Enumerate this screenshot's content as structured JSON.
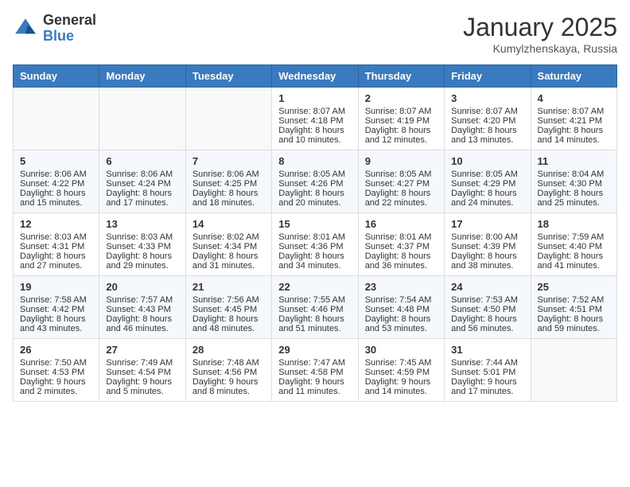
{
  "header": {
    "logo_general": "General",
    "logo_blue": "Blue",
    "month_title": "January 2025",
    "location": "Kumylzhenskaya, Russia"
  },
  "weekdays": [
    "Sunday",
    "Monday",
    "Tuesday",
    "Wednesday",
    "Thursday",
    "Friday",
    "Saturday"
  ],
  "weeks": [
    [
      {
        "day": "",
        "content": ""
      },
      {
        "day": "",
        "content": ""
      },
      {
        "day": "",
        "content": ""
      },
      {
        "day": "1",
        "content": "Sunrise: 8:07 AM\nSunset: 4:18 PM\nDaylight: 8 hours\nand 10 minutes."
      },
      {
        "day": "2",
        "content": "Sunrise: 8:07 AM\nSunset: 4:19 PM\nDaylight: 8 hours\nand 12 minutes."
      },
      {
        "day": "3",
        "content": "Sunrise: 8:07 AM\nSunset: 4:20 PM\nDaylight: 8 hours\nand 13 minutes."
      },
      {
        "day": "4",
        "content": "Sunrise: 8:07 AM\nSunset: 4:21 PM\nDaylight: 8 hours\nand 14 minutes."
      }
    ],
    [
      {
        "day": "5",
        "content": "Sunrise: 8:06 AM\nSunset: 4:22 PM\nDaylight: 8 hours\nand 15 minutes."
      },
      {
        "day": "6",
        "content": "Sunrise: 8:06 AM\nSunset: 4:24 PM\nDaylight: 8 hours\nand 17 minutes."
      },
      {
        "day": "7",
        "content": "Sunrise: 8:06 AM\nSunset: 4:25 PM\nDaylight: 8 hours\nand 18 minutes."
      },
      {
        "day": "8",
        "content": "Sunrise: 8:05 AM\nSunset: 4:26 PM\nDaylight: 8 hours\nand 20 minutes."
      },
      {
        "day": "9",
        "content": "Sunrise: 8:05 AM\nSunset: 4:27 PM\nDaylight: 8 hours\nand 22 minutes."
      },
      {
        "day": "10",
        "content": "Sunrise: 8:05 AM\nSunset: 4:29 PM\nDaylight: 8 hours\nand 24 minutes."
      },
      {
        "day": "11",
        "content": "Sunrise: 8:04 AM\nSunset: 4:30 PM\nDaylight: 8 hours\nand 25 minutes."
      }
    ],
    [
      {
        "day": "12",
        "content": "Sunrise: 8:03 AM\nSunset: 4:31 PM\nDaylight: 8 hours\nand 27 minutes."
      },
      {
        "day": "13",
        "content": "Sunrise: 8:03 AM\nSunset: 4:33 PM\nDaylight: 8 hours\nand 29 minutes."
      },
      {
        "day": "14",
        "content": "Sunrise: 8:02 AM\nSunset: 4:34 PM\nDaylight: 8 hours\nand 31 minutes."
      },
      {
        "day": "15",
        "content": "Sunrise: 8:01 AM\nSunset: 4:36 PM\nDaylight: 8 hours\nand 34 minutes."
      },
      {
        "day": "16",
        "content": "Sunrise: 8:01 AM\nSunset: 4:37 PM\nDaylight: 8 hours\nand 36 minutes."
      },
      {
        "day": "17",
        "content": "Sunrise: 8:00 AM\nSunset: 4:39 PM\nDaylight: 8 hours\nand 38 minutes."
      },
      {
        "day": "18",
        "content": "Sunrise: 7:59 AM\nSunset: 4:40 PM\nDaylight: 8 hours\nand 41 minutes."
      }
    ],
    [
      {
        "day": "19",
        "content": "Sunrise: 7:58 AM\nSunset: 4:42 PM\nDaylight: 8 hours\nand 43 minutes."
      },
      {
        "day": "20",
        "content": "Sunrise: 7:57 AM\nSunset: 4:43 PM\nDaylight: 8 hours\nand 46 minutes."
      },
      {
        "day": "21",
        "content": "Sunrise: 7:56 AM\nSunset: 4:45 PM\nDaylight: 8 hours\nand 48 minutes."
      },
      {
        "day": "22",
        "content": "Sunrise: 7:55 AM\nSunset: 4:46 PM\nDaylight: 8 hours\nand 51 minutes."
      },
      {
        "day": "23",
        "content": "Sunrise: 7:54 AM\nSunset: 4:48 PM\nDaylight: 8 hours\nand 53 minutes."
      },
      {
        "day": "24",
        "content": "Sunrise: 7:53 AM\nSunset: 4:50 PM\nDaylight: 8 hours\nand 56 minutes."
      },
      {
        "day": "25",
        "content": "Sunrise: 7:52 AM\nSunset: 4:51 PM\nDaylight: 8 hours\nand 59 minutes."
      }
    ],
    [
      {
        "day": "26",
        "content": "Sunrise: 7:50 AM\nSunset: 4:53 PM\nDaylight: 9 hours\nand 2 minutes."
      },
      {
        "day": "27",
        "content": "Sunrise: 7:49 AM\nSunset: 4:54 PM\nDaylight: 9 hours\nand 5 minutes."
      },
      {
        "day": "28",
        "content": "Sunrise: 7:48 AM\nSunset: 4:56 PM\nDaylight: 9 hours\nand 8 minutes."
      },
      {
        "day": "29",
        "content": "Sunrise: 7:47 AM\nSunset: 4:58 PM\nDaylight: 9 hours\nand 11 minutes."
      },
      {
        "day": "30",
        "content": "Sunrise: 7:45 AM\nSunset: 4:59 PM\nDaylight: 9 hours\nand 14 minutes."
      },
      {
        "day": "31",
        "content": "Sunrise: 7:44 AM\nSunset: 5:01 PM\nDaylight: 9 hours\nand 17 minutes."
      },
      {
        "day": "",
        "content": ""
      }
    ]
  ]
}
